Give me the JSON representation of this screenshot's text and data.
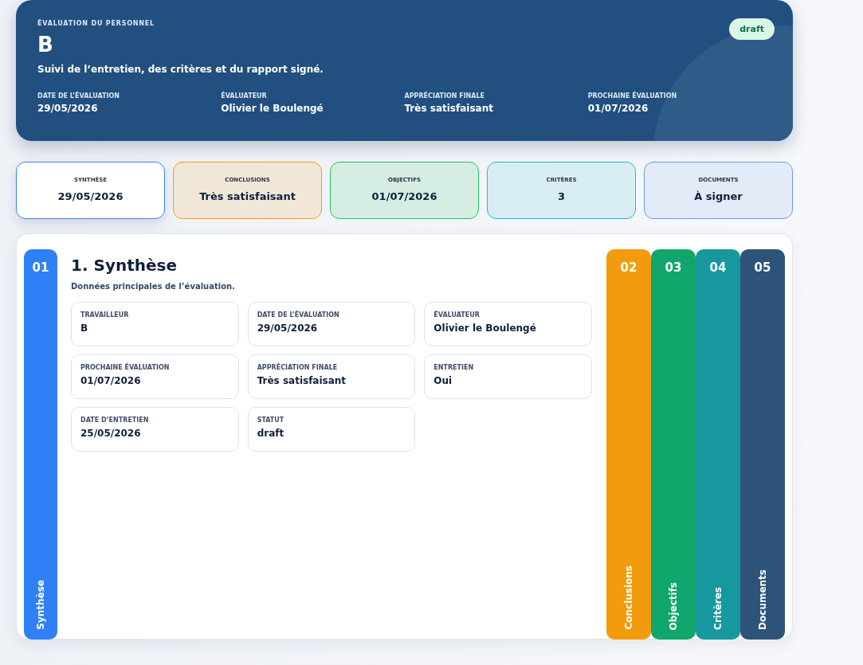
{
  "header": {
    "eyebrow": "ÉVALUATION DU PERSONNEL",
    "title": "B",
    "subtitle": "Suivi de l’entretien, des critères et du rapport signé.",
    "status": "draft",
    "facts": [
      {
        "label": "DATE DE L’ÉVALUATION",
        "value": "29/05/2026"
      },
      {
        "label": "ÉVALUATEUR",
        "value": "Olivier le Boulengé"
      },
      {
        "label": "APPRÉCIATION FINALE",
        "value": "Très satisfaisant"
      },
      {
        "label": "PROCHAINE ÉVALUATION",
        "value": "01/07/2026"
      }
    ]
  },
  "summary_cards": [
    {
      "label": "SYNTHÈSE",
      "value": "29/05/2026",
      "color": "#3b82f6",
      "selected": true
    },
    {
      "label": "CONCLUSIONS",
      "value": "Très satisfaisant",
      "color": "#f59e0b",
      "selected": false
    },
    {
      "label": "OBJECTIFS",
      "value": "01/07/2026",
      "color": "#22c55e",
      "selected": false
    },
    {
      "label": "CRITÈRES",
      "value": "3",
      "color": "#22b8cf",
      "selected": false
    },
    {
      "label": "DOCUMENTS",
      "value": "À signer",
      "color": "#6b9be8",
      "selected": false
    }
  ],
  "sections": [
    {
      "number": "01",
      "label": "Synthèse",
      "color": "#2f80f7",
      "selected": true
    },
    {
      "number": "02",
      "label": "Conclusions",
      "color": "#f29c0d",
      "selected": false
    },
    {
      "number": "03",
      "label": "Objectifs",
      "color": "#10a66c",
      "selected": false
    },
    {
      "number": "04",
      "label": "Critères",
      "color": "#17989f",
      "selected": false
    },
    {
      "number": "05",
      "label": "Documents",
      "color": "#2d5378",
      "selected": false
    }
  ],
  "panel": {
    "title": "1. Synthèse",
    "subtitle": "Données principales de l’évaluation.",
    "fields": [
      {
        "label": "TRAVAILLEUR",
        "value": "B"
      },
      {
        "label": "DATE DE L’ÉVALUATION",
        "value": "29/05/2026"
      },
      {
        "label": "ÉVALUATEUR",
        "value": "Olivier le Boulengé"
      },
      {
        "label": "PROCHAINE ÉVALUATION",
        "value": "01/07/2026"
      },
      {
        "label": "APPRÉCIATION FINALE",
        "value": "Très satisfaisant"
      },
      {
        "label": "ENTRETIEN",
        "value": "Oui"
      },
      {
        "label": "DATE D’ENTRETIEN",
        "value": "25/05/2026"
      },
      {
        "label": "STATUT",
        "value": "draft"
      }
    ]
  }
}
